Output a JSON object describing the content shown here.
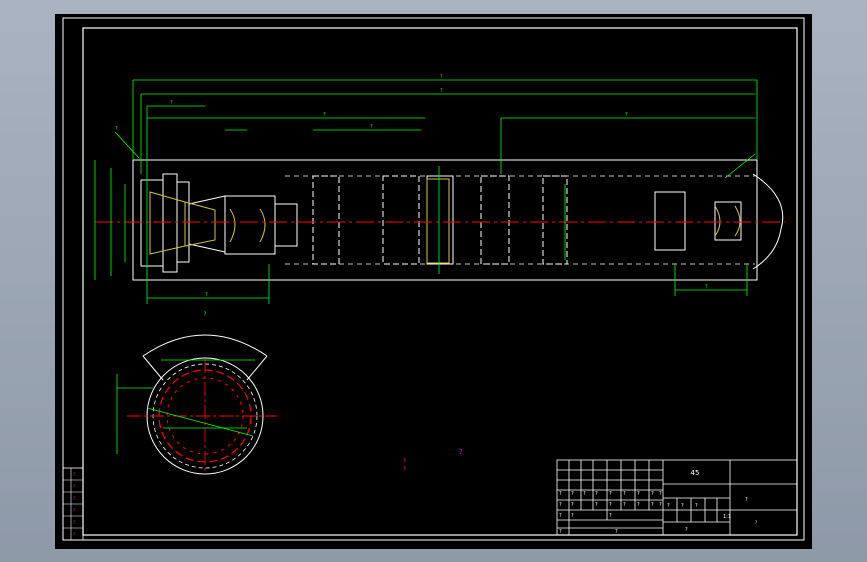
{
  "colors": {
    "frame": "#ffffff",
    "geometry": "#ffffff",
    "dimension": "#00ff00",
    "centerline": "#ff0000",
    "section_hatch": "#ff0000",
    "notes": "#ff00ff",
    "title_block": "#ffffff",
    "side_strip_text": "#ff00ff",
    "viewport_background": "#000000",
    "app_background": "#a1abba"
  },
  "dimensions": {
    "overall_length": "?",
    "overall_length_2": "?",
    "segment_a": "?",
    "segment_b": "?",
    "segment_c": "?",
    "segment_d": "?",
    "segment_e": "?",
    "segment_f": "?",
    "segment_g": "?"
  },
  "section_view": {
    "label": "?"
  },
  "notes": {
    "title": "?",
    "line1": "?",
    "line2": "?"
  },
  "title_block": {
    "material": "45",
    "drawing_name": "?",
    "code": "?",
    "scale": "1:1",
    "row1": [
      "?",
      "?",
      "?",
      "?",
      "?",
      "?",
      "?",
      "?",
      "?"
    ],
    "row2": [
      "?",
      "?",
      "?",
      "?",
      "?",
      "?",
      "?",
      "?"
    ],
    "row3": [
      "?",
      "?",
      "?"
    ],
    "row4": [
      "?",
      "?"
    ],
    "right_labels": [
      "?",
      "?",
      "?",
      "?"
    ]
  },
  "side_strip": [
    "?",
    "?",
    "?",
    "?",
    "?",
    "?"
  ]
}
